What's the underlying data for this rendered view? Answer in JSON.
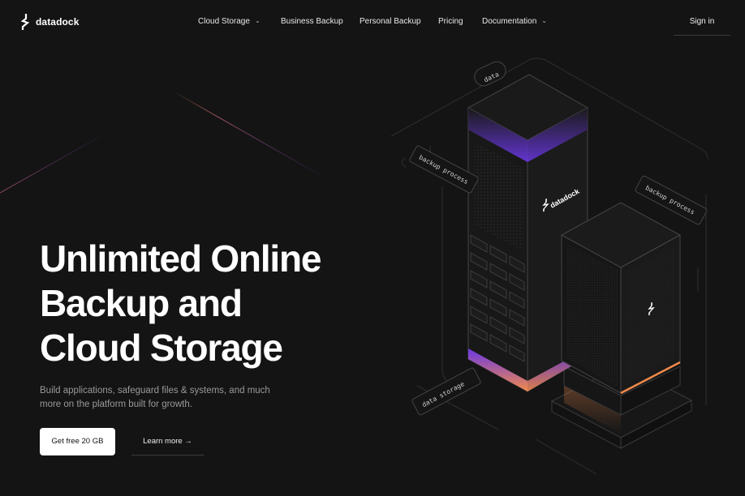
{
  "brand": {
    "name": "datadock"
  },
  "nav": {
    "items": [
      {
        "label": "Cloud Storage",
        "has_dropdown": true
      },
      {
        "label": "Business Backup",
        "has_dropdown": false
      },
      {
        "label": "Personal Backup",
        "has_dropdown": false
      },
      {
        "label": "Pricing",
        "has_dropdown": false
      },
      {
        "label": "Documentation",
        "has_dropdown": true
      }
    ],
    "signin_label": "Sign in"
  },
  "hero": {
    "title_lines": [
      "Unlimited Online",
      "Backup and",
      "Cloud Storage"
    ],
    "subtitle": "Build applications, safeguard files & systems, and much more on the platform built for growth.",
    "primary_cta": "Get free 20 GB",
    "secondary_cta": "Learn more →"
  },
  "illustration": {
    "tags": {
      "data": "data",
      "backup_left": "backup process",
      "backup_right": "backup process",
      "storage": "data storage"
    },
    "server_brand": "datadock"
  },
  "colors": {
    "background": "#141414",
    "accent_purple": "#7b3ff2",
    "accent_orange": "#f08a4b"
  }
}
